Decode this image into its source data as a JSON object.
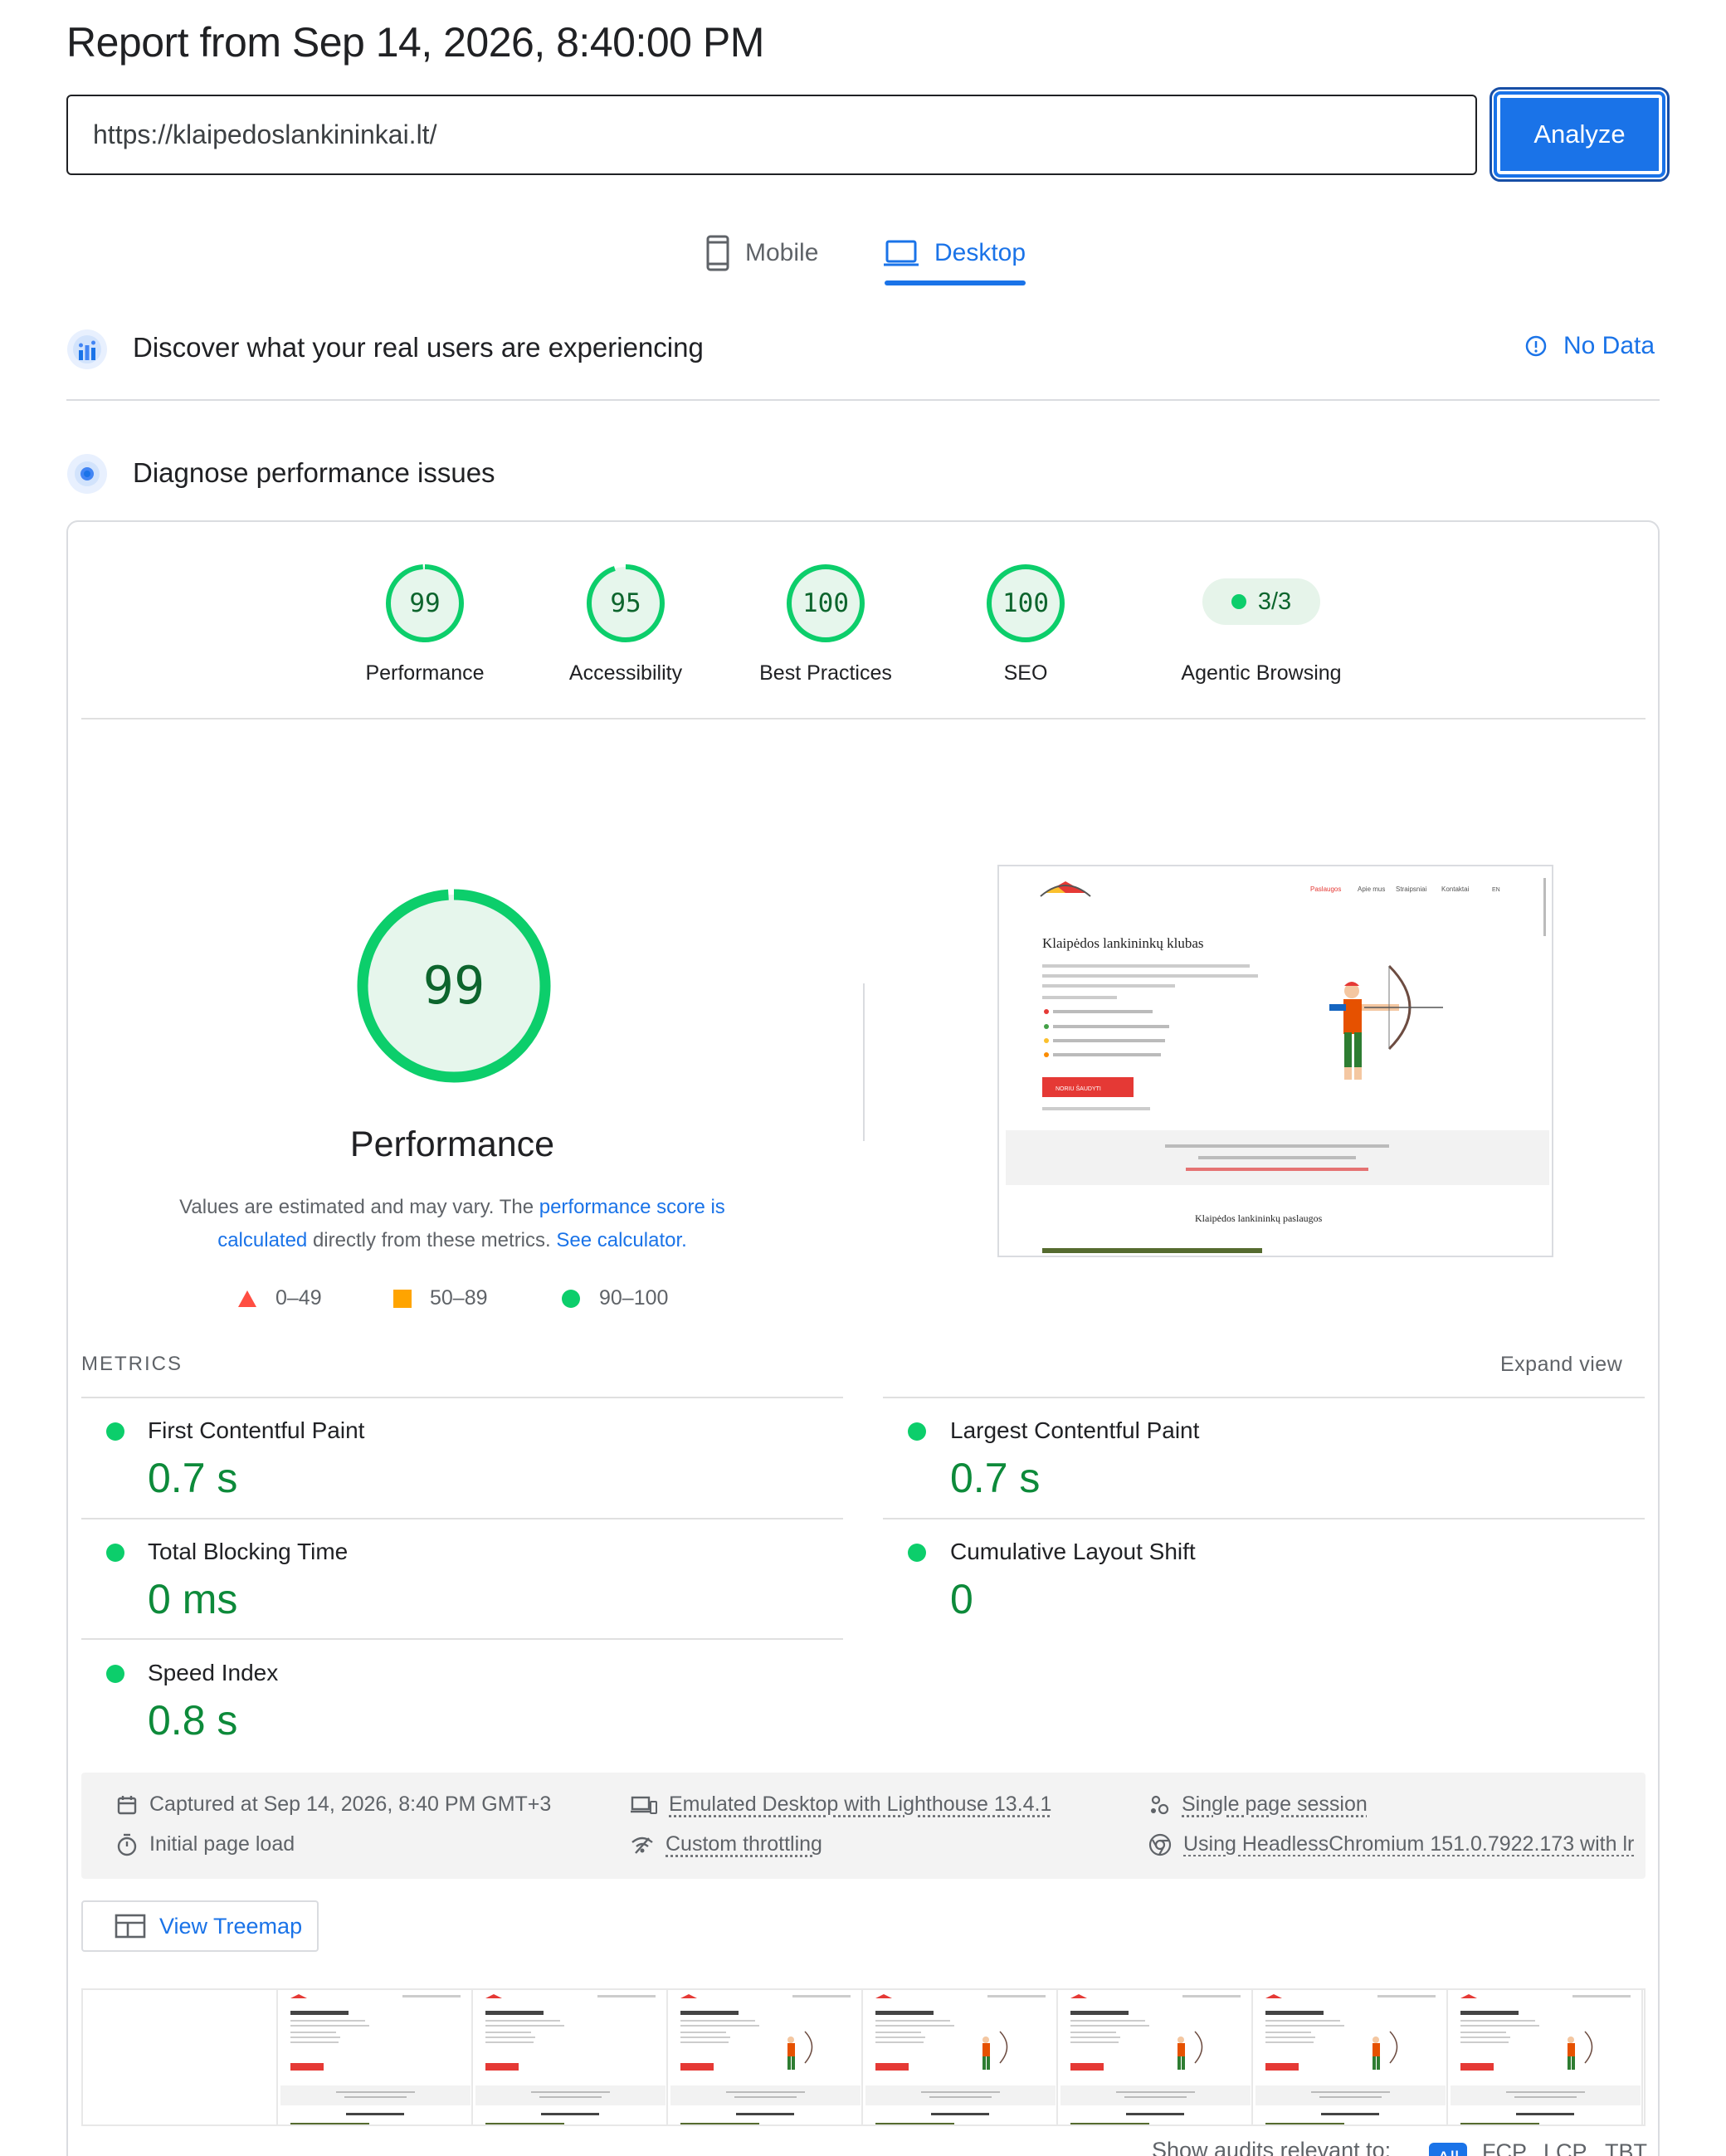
{
  "header": {
    "report_title": "Report from Sep 14, 2026, 8:40:00 PM",
    "url_value": "https://klaipedoslankininkai.lt/",
    "analyze_label": "Analyze"
  },
  "tabs": {
    "mobile_label": "Mobile",
    "desktop_label": "Desktop",
    "active": "Desktop"
  },
  "field_data": {
    "title": "Discover what your real users are experiencing",
    "status": "No Data"
  },
  "diagnose": {
    "title": "Diagnose performance issues"
  },
  "scores": [
    {
      "label": "Performance",
      "value": "99",
      "fraction": 0.99
    },
    {
      "label": "Accessibility",
      "value": "95",
      "fraction": 0.95
    },
    {
      "label": "Best Practices",
      "value": "100",
      "fraction": 1.0
    },
    {
      "label": "SEO",
      "value": "100",
      "fraction": 1.0
    }
  ],
  "agentic": {
    "label": "Agentic Browsing",
    "value": "3/3"
  },
  "performance": {
    "score": "99",
    "fraction": 0.99,
    "title": "Performance",
    "desc_1": "Values are estimated and may vary. The ",
    "desc_link_1": "performance score is calculated",
    "desc_2": " directly from these metrics. ",
    "desc_link_2": "See calculator."
  },
  "legend": {
    "fail": "0–49",
    "average": "50–89",
    "pass": "90–100"
  },
  "preview": {
    "site_title": "Klaipėdos lankininkų klubas",
    "nav_items": [
      "Paslaugos",
      "Apie mus",
      "Straipsniai",
      "Kontaktai",
      "EN"
    ],
    "cta": "NORIU ŠAUDYTI",
    "section_title": "Klaipėdos lankininkų paslaugos"
  },
  "metrics": {
    "header": "METRICS",
    "expand": "Expand view",
    "items": [
      {
        "name": "First Contentful Paint",
        "value": "0.7 s"
      },
      {
        "name": "Largest Contentful Paint",
        "value": "0.7 s"
      },
      {
        "name": "Total Blocking Time",
        "value": "0 ms"
      },
      {
        "name": "Cumulative Layout Shift",
        "value": "0"
      },
      {
        "name": "Speed Index",
        "value": "0.8 s"
      }
    ]
  },
  "info": {
    "captured": "Captured at Sep 14, 2026, 8:40 PM GMT+3",
    "initial": "Initial page load",
    "emulated": "Emulated Desktop with Lighthouse 13.4.1",
    "throttling": "Custom throttling",
    "session": "Single page session",
    "browser": "Using HeadlessChromium 151.0.7922.173 with lr"
  },
  "treemap_label": "View Treemap",
  "bottom": {
    "show_audits": "Show audits relevant to:",
    "chips": [
      "All",
      "FCP",
      "LCP",
      "TBT"
    ]
  },
  "colors": {
    "accent": "#1a73e8",
    "pass": "#0cce6b",
    "pass_text": "#0d652d",
    "average": "#ffa400",
    "fail": "#ff4e42"
  }
}
